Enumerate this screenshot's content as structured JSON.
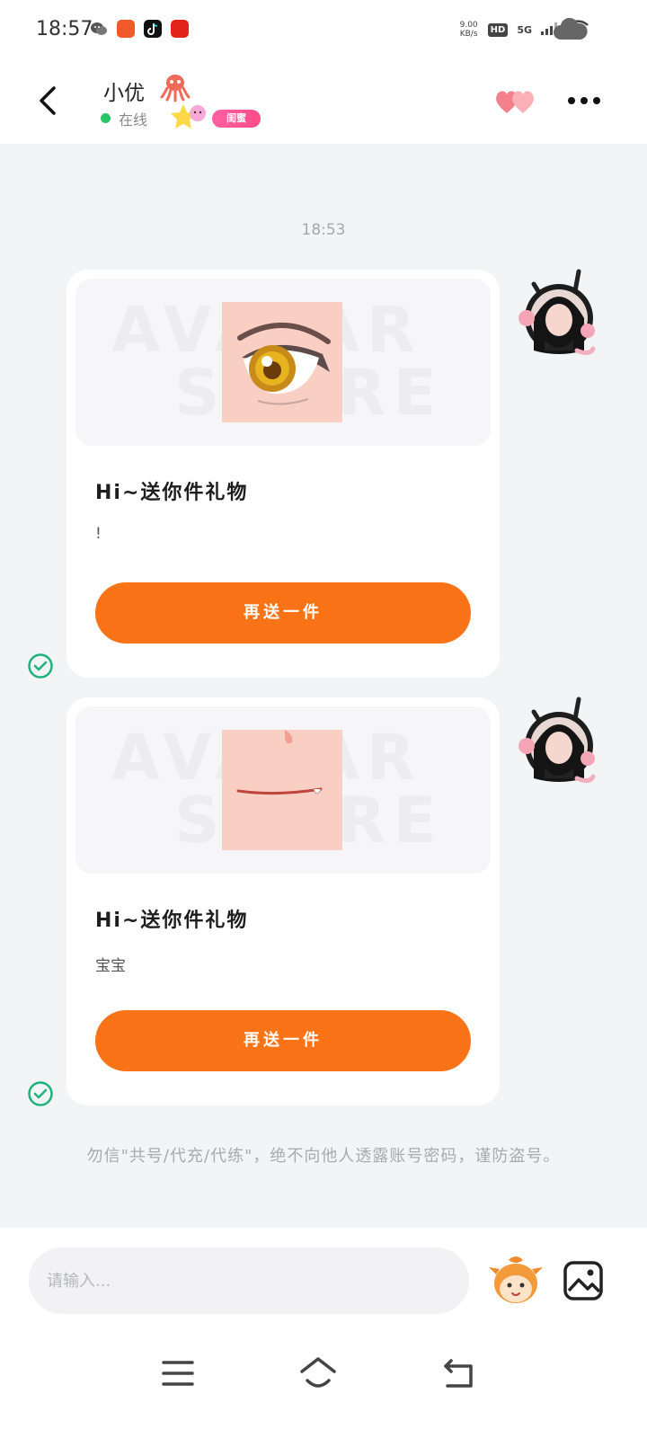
{
  "status_bar": {
    "time": "18:57",
    "net_speed_value": "9.00",
    "net_speed_unit": "KB/s",
    "hd_label": "HD",
    "network_label": "5G",
    "app_icons": [
      "wechat-icon",
      "app-red-icon",
      "tiktok-icon",
      "pinduoduo-icon"
    ]
  },
  "header": {
    "contact_name": "小优",
    "status_text": "在线",
    "relation_badge": "闺蜜"
  },
  "chat": {
    "timestamp": "18:53",
    "messages": [
      {
        "gift_title": "Hi~送你件礼物",
        "gift_message": "!",
        "button_label": "再送一件",
        "gift_item": "eye"
      },
      {
        "gift_title": "Hi~送你件礼物",
        "gift_message": "宝宝",
        "button_label": "再送一件",
        "gift_item": "mouth"
      }
    ],
    "watermark_line1": "AVATAR",
    "watermark_line2": "STORE",
    "notice_text": "勿信\"共号/代充/代练\"，绝不向他人透露账号密码，谨防盗号。"
  },
  "input_bar": {
    "placeholder": "请输入..."
  },
  "colors": {
    "accent_orange": "#fb7317",
    "online_green": "#29c466",
    "badge_pink": "#ff4d88",
    "check_green": "#1fb37a"
  }
}
